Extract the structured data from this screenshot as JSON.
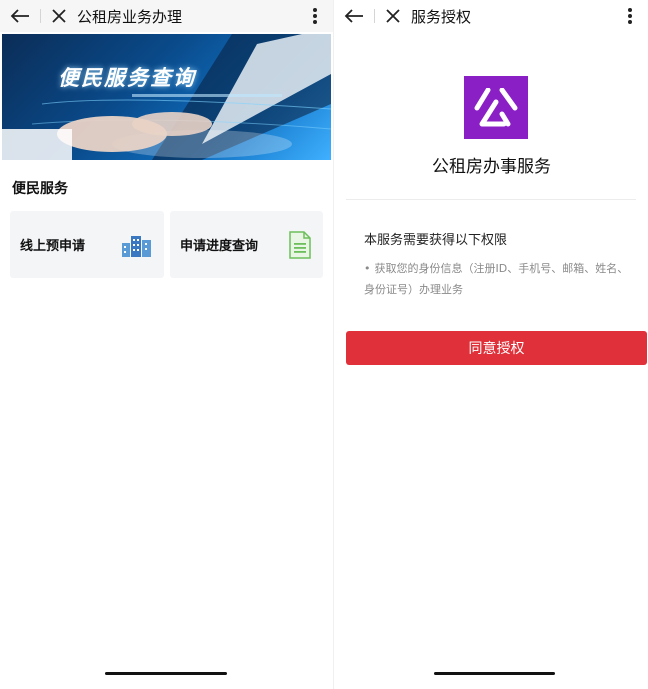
{
  "left_screen": {
    "header": {
      "title": "公租房业务办理"
    },
    "banner": {
      "text": "便民服务查询"
    },
    "section": {
      "title": "便民服务"
    },
    "cards": [
      {
        "label": "线上预申请",
        "icon": "buildings-icon"
      },
      {
        "label": "申请进度查询",
        "icon": "document-icon"
      }
    ]
  },
  "right_screen": {
    "header": {
      "title": "服务授权"
    },
    "app": {
      "name": "公租房办事服务",
      "logo_color": "#8a1fc6"
    },
    "permission": {
      "title": "本服务需要获得以下权限",
      "item": "获取您的身份信息（注册ID、手机号、邮箱、姓名、身份证号）办理业务",
      "bullet": "•"
    },
    "agree_button": {
      "label": "同意授权",
      "color": "#e0313a"
    }
  }
}
